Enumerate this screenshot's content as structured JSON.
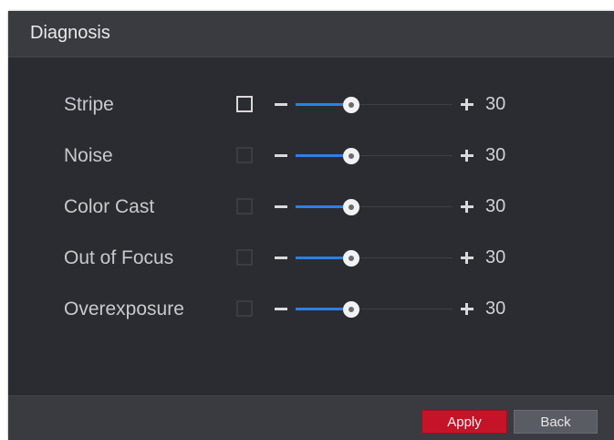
{
  "dialog": {
    "title": "Diagnosis"
  },
  "items": [
    {
      "label": "Stripe",
      "checked": false,
      "focused": true,
      "value": "30",
      "level": 0.3
    },
    {
      "label": "Noise",
      "checked": false,
      "focused": false,
      "value": "30",
      "level": 0.3
    },
    {
      "label": "Color Cast",
      "checked": false,
      "focused": false,
      "value": "30",
      "level": 0.3
    },
    {
      "label": "Out of Focus",
      "checked": false,
      "focused": false,
      "value": "30",
      "level": 0.3
    },
    {
      "label": "Overexposure",
      "checked": false,
      "focused": false,
      "value": "30",
      "level": 0.3
    }
  ],
  "footer": {
    "apply_label": "Apply",
    "back_label": "Back"
  },
  "colors": {
    "accent": "#2d7fe6",
    "apply": "#c51427",
    "background": "#2b2c31",
    "header": "#3a3b41"
  }
}
